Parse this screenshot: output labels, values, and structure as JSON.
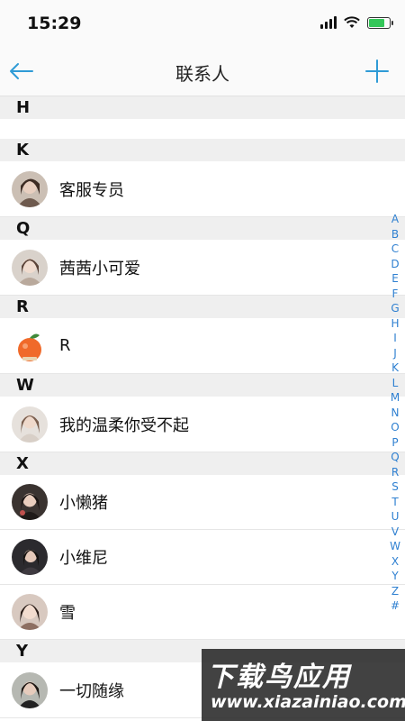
{
  "status_bar": {
    "time": "15:29"
  },
  "nav": {
    "title": "联系人"
  },
  "sections": [
    {
      "letter": "H",
      "contacts": []
    },
    {
      "letter": "K",
      "contacts": [
        {
          "name": "客服专员",
          "avatar": "photo-girl-avatar"
        }
      ]
    },
    {
      "letter": "Q",
      "contacts": [
        {
          "name": "茜茜小可爱",
          "avatar": "photo-girl-avatar"
        }
      ]
    },
    {
      "letter": "R",
      "contacts": [
        {
          "name": "R",
          "avatar": "orange-fruit-avatar"
        }
      ]
    },
    {
      "letter": "W",
      "contacts": [
        {
          "name": "我的温柔你受不起",
          "avatar": "photo-girl-avatar"
        }
      ]
    },
    {
      "letter": "X",
      "contacts": [
        {
          "name": "小懒猪",
          "avatar": "photo-girl-avatar"
        },
        {
          "name": "小维尼",
          "avatar": "photo-girl-avatar"
        },
        {
          "name": "雪",
          "avatar": "photo-girl-avatar"
        }
      ]
    },
    {
      "letter": "Y",
      "contacts": [
        {
          "name": "一切随缘",
          "avatar": "photo-girl-avatar"
        }
      ]
    }
  ],
  "index_letters": [
    "A",
    "B",
    "C",
    "D",
    "E",
    "F",
    "G",
    "H",
    "I",
    "J",
    "K",
    "L",
    "M",
    "N",
    "O",
    "P",
    "Q",
    "R",
    "S",
    "T",
    "U",
    "V",
    "W",
    "X",
    "Y",
    "Z",
    "#"
  ],
  "colors": {
    "accent": "#2f80d1",
    "section_bg": "#efefef",
    "battery": "#34c759"
  },
  "watermark": {
    "main": "下载鸟应用",
    "sub": "www.xiazainiao.com"
  }
}
